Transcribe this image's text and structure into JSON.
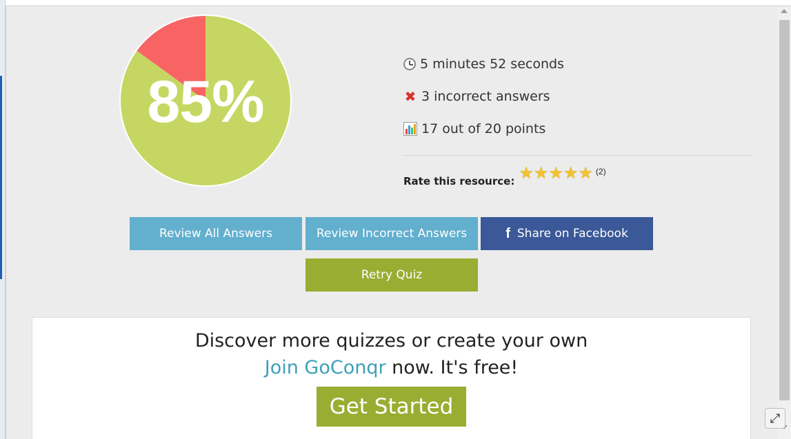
{
  "result": {
    "percent_label": "85%",
    "score_fraction": 0.85,
    "correct_color": "#c5d762",
    "incorrect_color": "#f86464"
  },
  "stats": {
    "time": {
      "icon": "clock-icon",
      "text": "5 minutes 52 seconds"
    },
    "incorrect": {
      "icon": "x-icon",
      "symbol": "✖",
      "text": "3 incorrect answers"
    },
    "points": {
      "icon": "bar-chart-icon",
      "text": "17 out of 20 points"
    }
  },
  "rating": {
    "label": "Rate this resource:",
    "stars": 5,
    "count": "(2)"
  },
  "buttons": {
    "review_all": "Review All Answers",
    "review_incorrect": "Review Incorrect Answers",
    "facebook_icon": "f",
    "facebook": "Share on Facebook",
    "retry": "Retry Quiz"
  },
  "promo": {
    "line1": "Discover more quizzes or create your own",
    "link": "Join GoConqr",
    "line2_rest": " now. It's free!",
    "cta": "Get Started"
  },
  "colors": {
    "review_button": "#62afce",
    "facebook_button": "#3b5998",
    "retry_button": "#9aad33",
    "link": "#3ea0b8"
  },
  "expand_icon": "⤢"
}
